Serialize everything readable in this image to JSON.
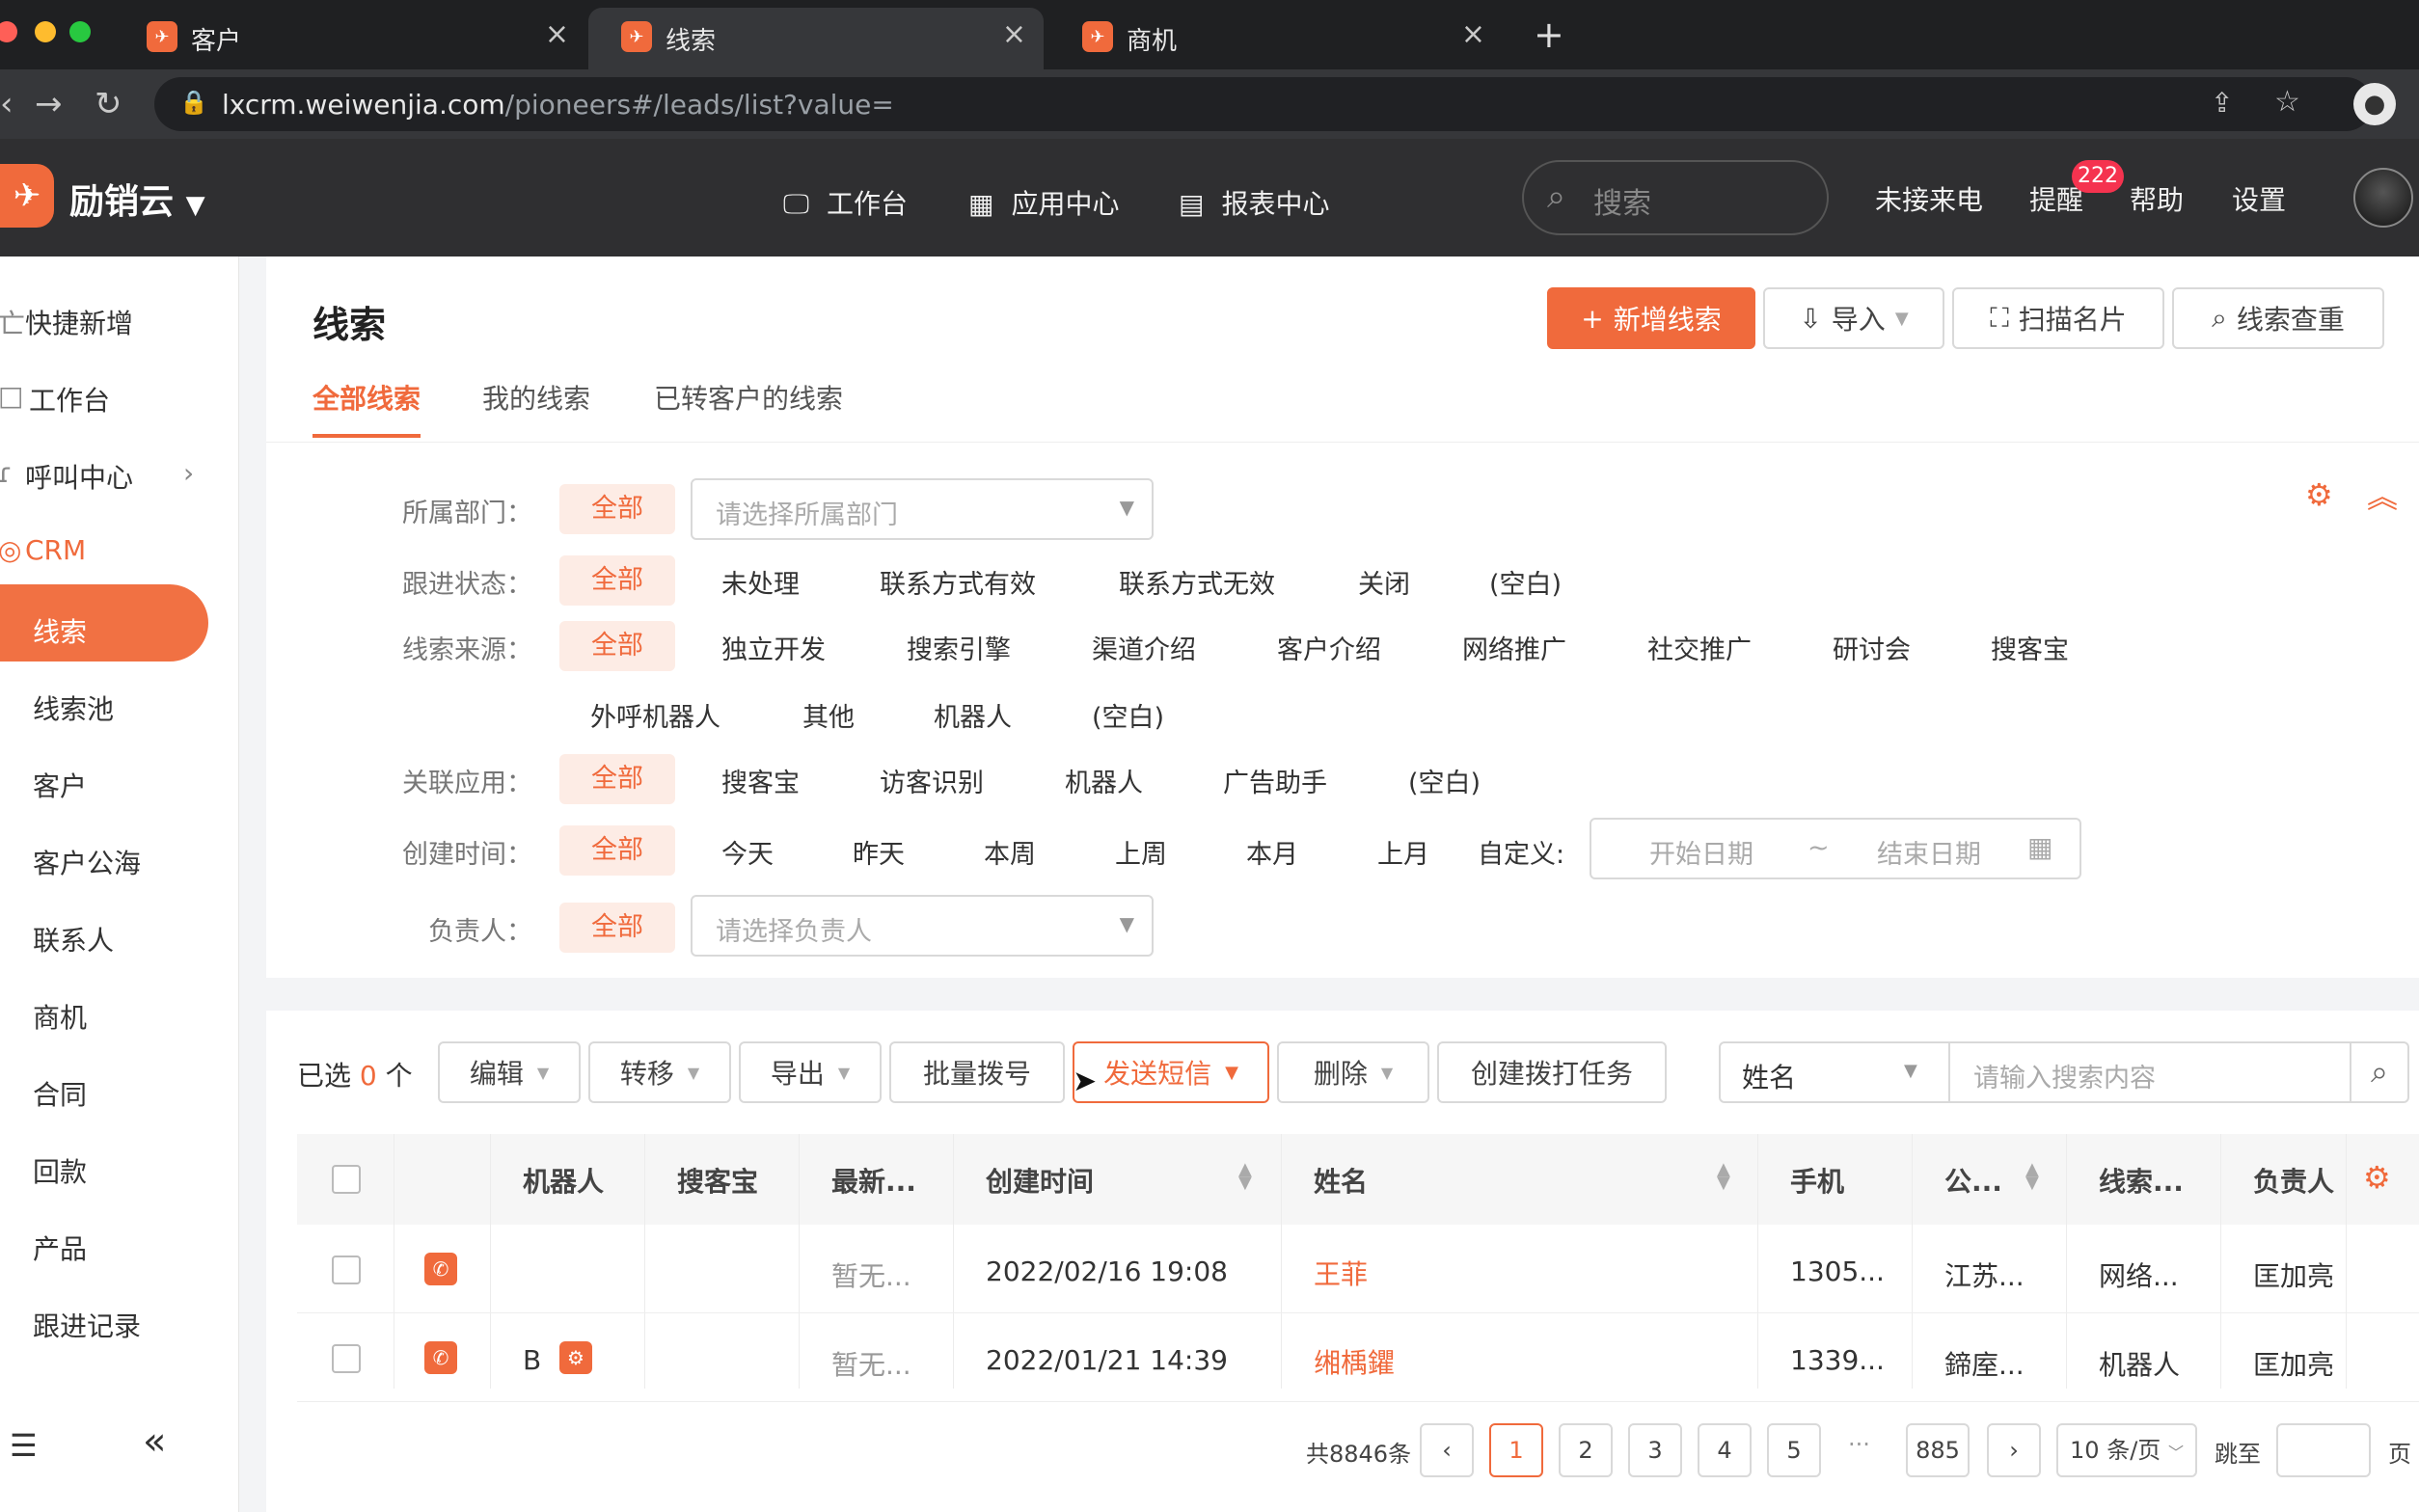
{
  "browser": {
    "tabs": [
      {
        "label": "客户",
        "fav": "✈"
      },
      {
        "label": "线索",
        "fav": "✈"
      },
      {
        "label": "商机",
        "fav": "✈"
      }
    ],
    "url_host": "lxcrm.weiwenjia.com",
    "url_path": "/pioneers#/leads/list?value="
  },
  "header": {
    "brand": "励销云",
    "nav": [
      "工作台",
      "应用中心",
      "报表中心"
    ],
    "search_placeholder": "搜索",
    "links": [
      "未接来电",
      "提醒",
      "帮助",
      "设置"
    ],
    "badge": "222"
  },
  "sidebar": {
    "items": [
      "快捷新增",
      "工作台",
      "呼叫中心",
      "CRM",
      "线索",
      "线索池",
      "客户",
      "客户公海",
      "联系人",
      "商机",
      "合同",
      "回款",
      "产品",
      "跟进记录"
    ]
  },
  "page": {
    "title": "线索",
    "actions": [
      "新增线索",
      "导入",
      "扫描名片",
      "线索查重"
    ],
    "tabs": [
      "全部线索",
      "我的线索",
      "已转客户的线索"
    ]
  },
  "filters": {
    "all": "全部",
    "dept_label": "所属部门：",
    "dept_placeholder": "请选择所属部门",
    "status_label": "跟进状态：",
    "status": [
      "未处理",
      "联系方式有效",
      "联系方式无效",
      "关闭",
      "(空白)"
    ],
    "source_label": "线索来源：",
    "source_row1": [
      "独立开发",
      "搜索引擎",
      "渠道介绍",
      "客户介绍",
      "网络推广",
      "社交推广",
      "研讨会",
      "搜客宝"
    ],
    "source_row2": [
      "外呼机器人",
      "其他",
      "机器人",
      "(空白)"
    ],
    "app_label": "关联应用：",
    "apps": [
      "搜客宝",
      "访客识别",
      "机器人",
      "广告助手",
      "(空白)"
    ],
    "time_label": "创建时间：",
    "times": [
      "今天",
      "昨天",
      "本周",
      "上周",
      "本月",
      "上月",
      "自定义:"
    ],
    "date_start": "开始日期",
    "date_sep": "~",
    "date_end": "结束日期",
    "owner_label": "负责人：",
    "owner_placeholder": "请选择负责人"
  },
  "toolbar": {
    "selected_prefix": "已选",
    "selected_count": "0",
    "selected_suffix": "个",
    "buttons": [
      "编辑",
      "转移",
      "导出",
      "批量拨号",
      "发送短信",
      "删除",
      "创建拨打任务"
    ],
    "field_select": "姓名",
    "search_placeholder": "请输入搜索内容"
  },
  "table": {
    "headers": [
      "机器人",
      "搜客宝",
      "最新...",
      "创建时间",
      "姓名",
      "手机",
      "公...",
      "线索...",
      "负责人"
    ],
    "rows": [
      {
        "robot": "",
        "latest": "暂无...",
        "created": "2022/02/16 19:08",
        "name": "王菲",
        "phone": "1305...",
        "company": "江苏...",
        "source": "网络...",
        "owner": "匡加亮"
      },
      {
        "robot": "B",
        "latest": "暂无...",
        "created": "2022/01/21 14:39",
        "name": "缃楀鑺",
        "phone": "1339...",
        "company": "鍗庢...",
        "source": "机器人",
        "owner": "匡加亮"
      }
    ]
  },
  "pagination": {
    "total": "共8846条",
    "pages": [
      "1",
      "2",
      "3",
      "4",
      "5"
    ],
    "ellipsis": "···",
    "last": "885",
    "page_size": "10 条/页",
    "jump_label": "跳至",
    "page_suffix": "页"
  },
  "colors": {
    "accent": "#f06a3c",
    "header_bg": "#2f2f31"
  }
}
